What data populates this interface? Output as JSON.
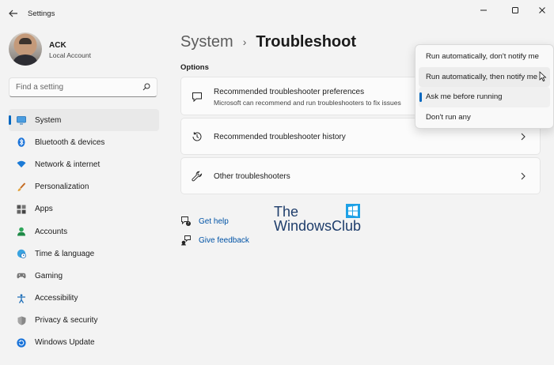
{
  "window": {
    "title": "Settings",
    "back_icon": "back-arrow-icon"
  },
  "profile": {
    "name": "ACK",
    "account_type": "Local Account"
  },
  "search": {
    "placeholder": "Find a setting"
  },
  "sidebar": {
    "items": [
      {
        "label": "System",
        "icon": "system-icon",
        "active": true
      },
      {
        "label": "Bluetooth & devices",
        "icon": "bluetooth-icon"
      },
      {
        "label": "Network & internet",
        "icon": "wifi-icon"
      },
      {
        "label": "Personalization",
        "icon": "brush-icon"
      },
      {
        "label": "Apps",
        "icon": "apps-icon"
      },
      {
        "label": "Accounts",
        "icon": "accounts-icon"
      },
      {
        "label": "Time & language",
        "icon": "globe-clock-icon"
      },
      {
        "label": "Gaming",
        "icon": "gamepad-icon"
      },
      {
        "label": "Accessibility",
        "icon": "accessibility-icon"
      },
      {
        "label": "Privacy & security",
        "icon": "shield-icon"
      },
      {
        "label": "Windows Update",
        "icon": "update-icon"
      }
    ]
  },
  "breadcrumb": {
    "parent": "System",
    "separator": "›",
    "current": "Troubleshoot"
  },
  "main": {
    "section_label": "Options",
    "cards": [
      {
        "title": "Recommended troubleshooter preferences",
        "description": "Microsoft can recommend and run troubleshooters to fix issues",
        "icon": "chat-icon"
      },
      {
        "title": "Recommended troubleshooter history",
        "icon": "history-icon"
      },
      {
        "title": "Other troubleshooters",
        "icon": "wrench-icon"
      }
    ],
    "help_links": [
      {
        "label": "Get help",
        "icon": "help-icon"
      },
      {
        "label": "Give feedback",
        "icon": "feedback-icon"
      }
    ]
  },
  "dropdown": {
    "options": [
      "Run automatically, don't notify me",
      "Run automatically, then notify me",
      "Ask me before running",
      "Don't run any"
    ],
    "selected": "Ask me before running",
    "hovered": "Run automatically, then notify me"
  },
  "watermark": {
    "line1": "The",
    "line2": "WindowsClub"
  },
  "colors": {
    "accent": "#0067c0",
    "link": "#0053a6",
    "background": "#f3f3f3",
    "card": "#fbfbfb"
  }
}
